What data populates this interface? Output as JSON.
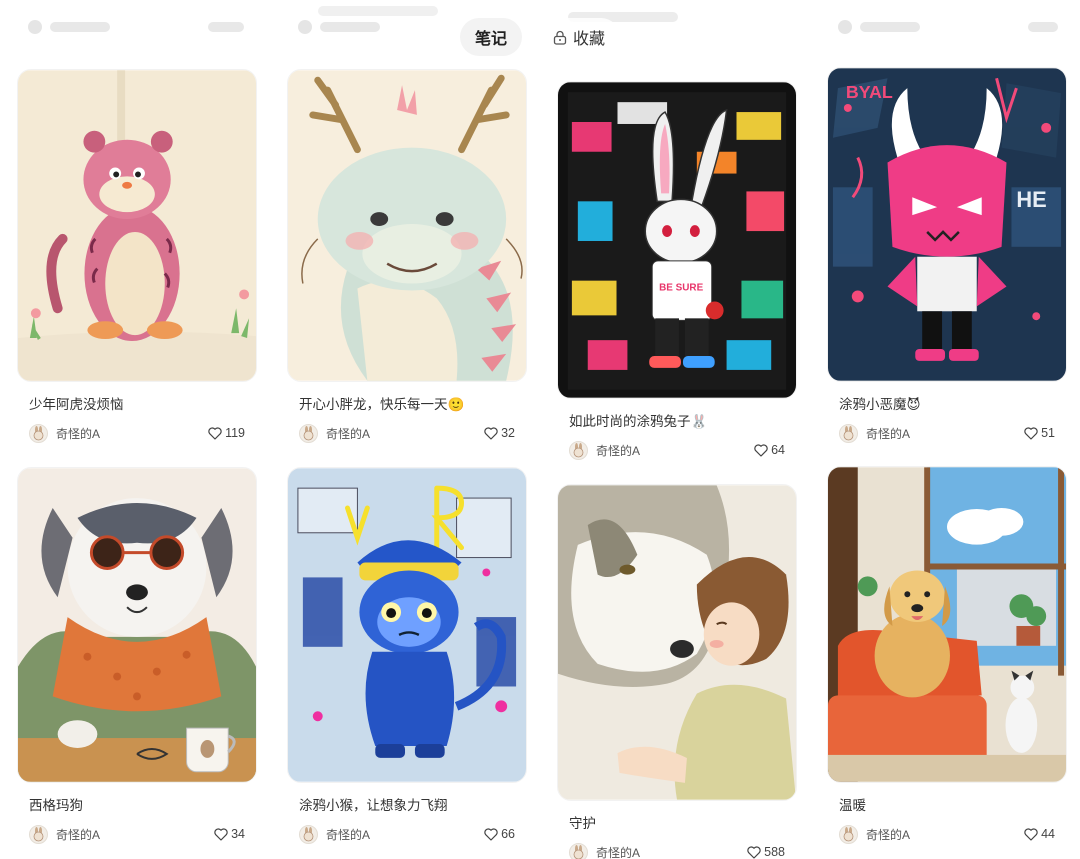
{
  "tabs": [
    {
      "label": "笔记",
      "active": true
    },
    {
      "label": "收藏",
      "active": false,
      "icon": "lock-icon"
    }
  ],
  "author_name": "奇怪的A",
  "notes": [
    {
      "title": "少年阿虎没烦恼",
      "likes": "119",
      "image": "cartoon-tiger-illustration"
    },
    {
      "title": "开心小胖龙，快乐每一天🙂",
      "likes": "32",
      "image": "cartoon-dragon-illustration"
    },
    {
      "title": "如此时尚的涂鸦兔子🐰",
      "likes": "64",
      "image": "graffiti-rabbit-illustration"
    },
    {
      "title": "涂鸦小恶魔😈",
      "likes": "51",
      "image": "graffiti-devil-illustration"
    },
    {
      "title": "西格玛狗",
      "likes": "34",
      "image": "sigma-dog-illustration"
    },
    {
      "title": "涂鸦小猴，让想象力飞翔",
      "likes": "66",
      "image": "graffiti-monkey-illustration"
    },
    {
      "title": "守护",
      "likes": "588",
      "image": "dog-and-child-illustration"
    },
    {
      "title": "温暖",
      "likes": "44",
      "image": "golden-dog-on-sofa-illustration"
    }
  ],
  "colors": {
    "tab_active_bg": "#f3f3f3",
    "text": "#333333"
  }
}
